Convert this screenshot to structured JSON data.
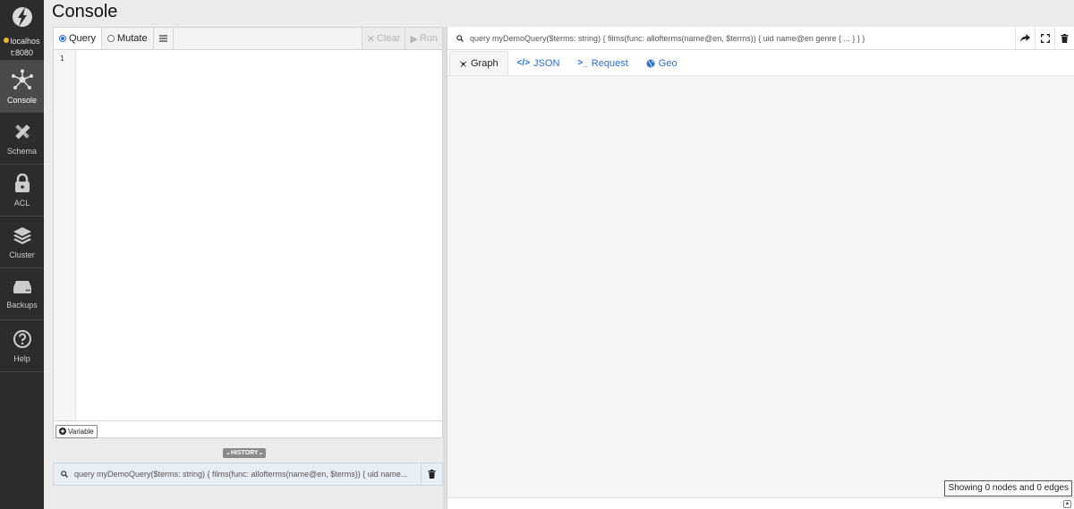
{
  "app": {
    "title": "Console"
  },
  "sidebar": {
    "server": {
      "line1": "localhos",
      "line2": "t:8080",
      "status_color": "#f2b632"
    },
    "items": [
      {
        "label": "Console",
        "icon": "graph-nodes-icon"
      },
      {
        "label": "Schema",
        "icon": "ruler-pencil-icon"
      },
      {
        "label": "ACL",
        "icon": "lock-icon"
      },
      {
        "label": "Cluster",
        "icon": "layers-icon"
      },
      {
        "label": "Backups",
        "icon": "hard-drive-icon"
      },
      {
        "label": "Help",
        "icon": "question-circle-icon"
      }
    ]
  },
  "editor": {
    "mode_query": "Query",
    "mode_mutate": "Mutate",
    "selected_mode": "Query",
    "clear_label": "Clear",
    "run_label": "Run",
    "line_number": "1",
    "variable_label": "Variable"
  },
  "history": {
    "label": "HISTORY",
    "item": "query myDemoQuery($terms: string) { films(func: allofterms(name@en, $terms)) { uid name..."
  },
  "results": {
    "query": "query myDemoQuery($terms: string) { films(func: allofterms(name@en, $terms)) { uid name@en genre { ... } } }",
    "tabs": [
      {
        "label": "Graph",
        "icon": "graph-icon"
      },
      {
        "label": "JSON",
        "icon": "code-icon"
      },
      {
        "label": "Request",
        "icon": "terminal-icon"
      },
      {
        "label": "Geo",
        "icon": "globe-icon"
      }
    ],
    "active_tab": "Graph",
    "status": "Showing 0 nodes and 0 edges"
  },
  "colors": {
    "accent": "#2b6fd6",
    "sidebar": "#2c2c2c"
  }
}
